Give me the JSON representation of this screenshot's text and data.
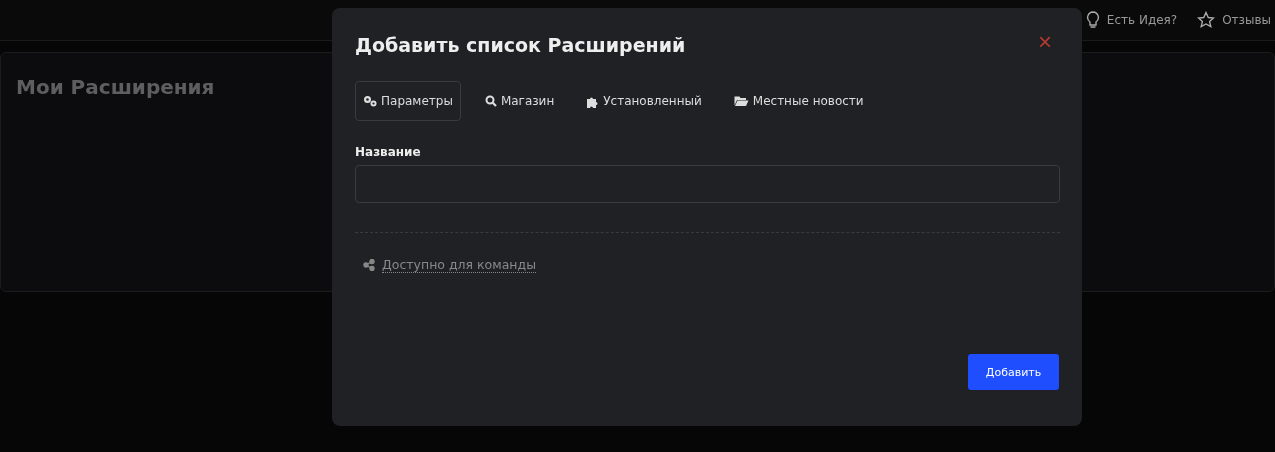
{
  "top_bar": {
    "items": [
      {
        "kind": "idea",
        "label": "Есть Идея?"
      },
      {
        "kind": "reviews",
        "label": "Отзывы"
      }
    ]
  },
  "page": {
    "title": "Мои Расширения"
  },
  "modal": {
    "title": "Добавить список Расширений",
    "close": "×",
    "tabs": [
      {
        "kind": "params",
        "label": "Параметры",
        "selected": true
      },
      {
        "kind": "store",
        "label": "Магазин",
        "selected": false
      },
      {
        "kind": "installed",
        "label": "Установленный",
        "selected": false
      },
      {
        "kind": "local",
        "label": "Местные новости",
        "selected": false
      }
    ],
    "name_field": {
      "label": "Название"
    },
    "team_link": "Доступно для команды",
    "submit": "Добавить"
  }
}
